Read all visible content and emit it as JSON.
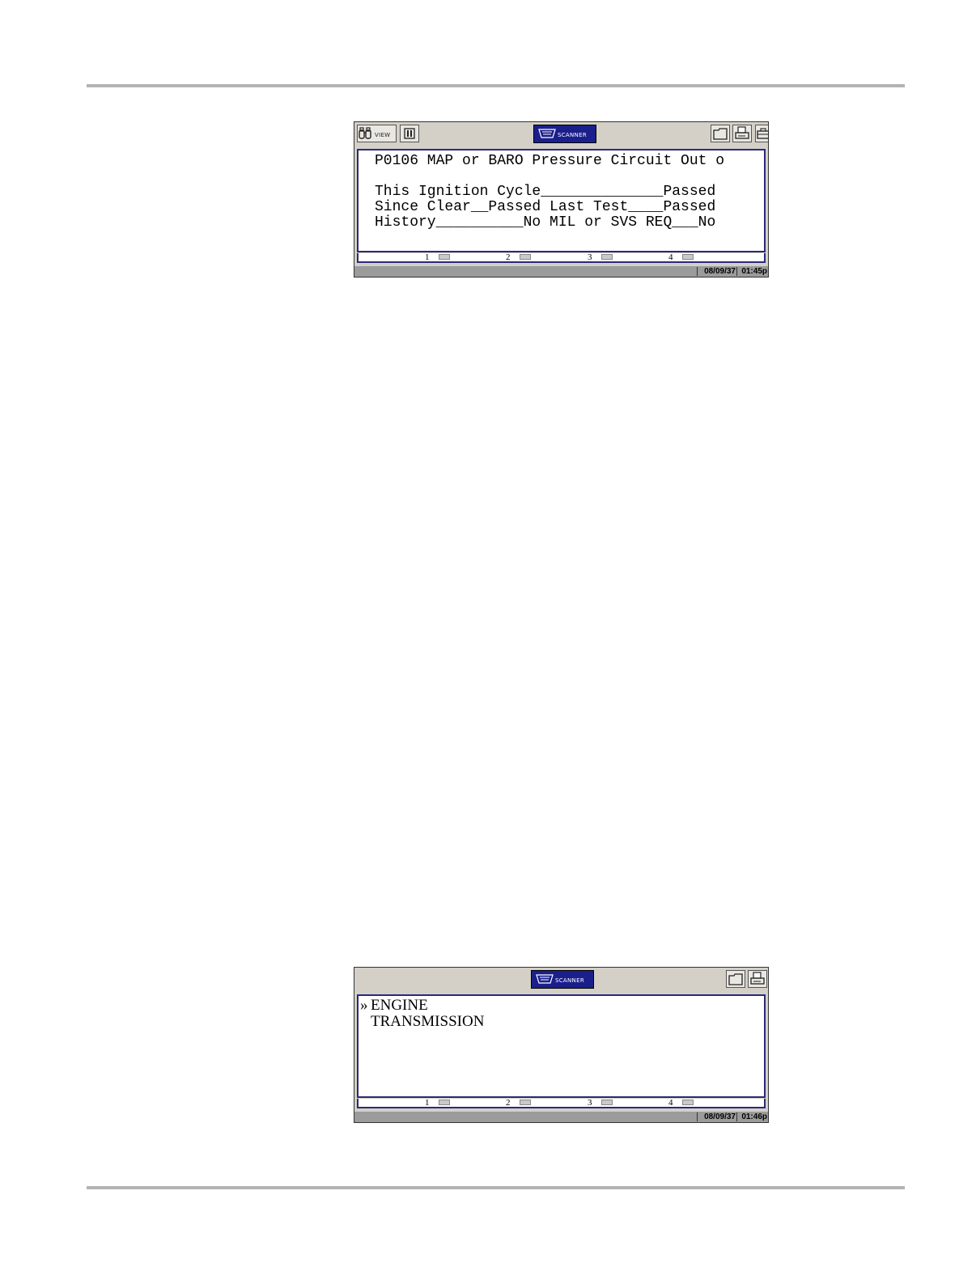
{
  "screen1": {
    "badge_label": "SCANNER",
    "view_label": "VIEW",
    "lines": [
      "P0106 MAP or BARO Pressure Circuit Out o",
      "This Ignition Cycle______________Passed",
      "Since Clear__Passed Last Test____Passed",
      "History__________No MIL or SVS REQ___No"
    ],
    "fkeys": [
      "1",
      "2",
      "3",
      "4"
    ],
    "date": "08/09/37",
    "time": "01:45p"
  },
  "screen2": {
    "badge_label": "SCANNER",
    "menu_pointer": "»",
    "menu": [
      "ENGINE",
      "TRANSMISSION"
    ],
    "fkeys": [
      "1",
      "2",
      "3",
      "4"
    ],
    "date": "08/09/37",
    "time": "01:46p"
  },
  "icons": {
    "view": "binoculars-icon",
    "pause": "pause-icon",
    "folder": "folder-icon",
    "print": "printer-icon",
    "toolbox": "toolbox-icon",
    "badge": "connector-icon"
  },
  "colors": {
    "badge_bg": "#1b1f8c",
    "screen_border": "#2a2a7a",
    "status_bg": "#9b9b9b"
  }
}
